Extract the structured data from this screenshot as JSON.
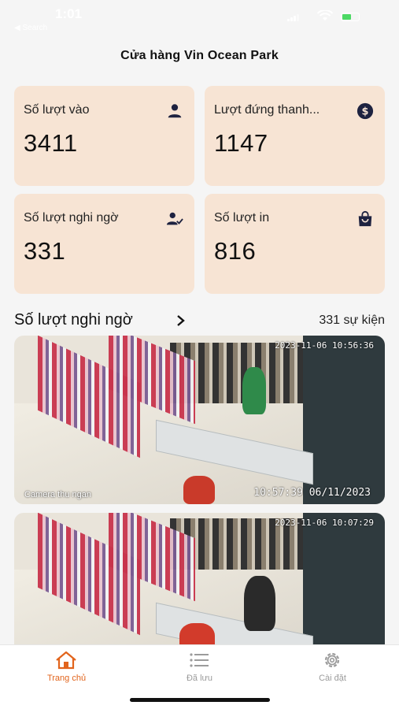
{
  "status_bar": {
    "time": "1:01",
    "back_label": "◀ Search"
  },
  "page": {
    "title": "Cửa hàng Vin Ocean Park"
  },
  "stats": [
    {
      "label": "Số lượt vào",
      "value": "3411",
      "icon": "person-icon"
    },
    {
      "label": "Lượt đứng thanh...",
      "value": "1147",
      "icon": "dollar-circle-icon"
    },
    {
      "label": "Số lượt nghi ngờ",
      "value": "331",
      "icon": "person-check-icon"
    },
    {
      "label": "Số lượt in",
      "value": "816",
      "icon": "shopping-bag-icon"
    }
  ],
  "section": {
    "title": "Số lượt nghi ngờ",
    "count": "331 sự kiện"
  },
  "events": [
    {
      "timestamp_overlay": "2023-11-06 10:56:36",
      "timestamp": "10:57:39 06/11/2023",
      "camera_name": "Camera thu ngan"
    },
    {
      "timestamp_overlay": "2023-11-06 10:07:29"
    }
  ],
  "tabs": [
    {
      "label": "Trang chủ",
      "icon": "home-icon",
      "active": true
    },
    {
      "label": "Đã lưu",
      "icon": "list-icon",
      "active": false
    },
    {
      "label": "Cài đặt",
      "icon": "gear-icon",
      "active": false
    }
  ],
  "colors": {
    "card_bg": "#f7e4d4",
    "accent": "#e2641c",
    "page_bg": "#f5f5f5"
  }
}
